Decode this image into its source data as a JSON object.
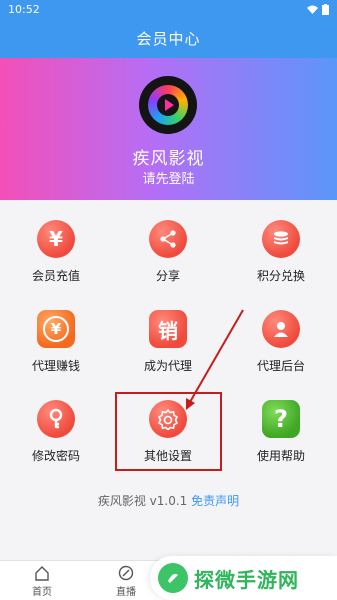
{
  "status": {
    "time": "10:52"
  },
  "header": {
    "title": "会员中心"
  },
  "profile": {
    "app_name": "疾风影视",
    "login_hint": "请先登陆"
  },
  "menu": [
    {
      "label": "会员充值",
      "icon": "yen-icon"
    },
    {
      "label": "分享",
      "icon": "share-icon"
    },
    {
      "label": "积分兑换",
      "icon": "coins-icon"
    },
    {
      "label": "代理赚钱",
      "icon": "yen-coin-icon"
    },
    {
      "label": "成为代理",
      "icon": "sell-icon",
      "glyph": "销"
    },
    {
      "label": "代理后台",
      "icon": "user-icon"
    },
    {
      "label": "修改密码",
      "icon": "key-icon"
    },
    {
      "label": "其他设置",
      "icon": "settings-icon"
    },
    {
      "label": "使用帮助",
      "icon": "help-icon",
      "glyph": "?"
    }
  ],
  "footer": {
    "version": "疾风影视 v1.0.1 ",
    "disclaimer": "免责声明"
  },
  "tabs": [
    {
      "label": "首页"
    },
    {
      "label": "直播"
    }
  ],
  "watermark": {
    "text": "探微手游网"
  },
  "colors": {
    "accent": "#3e98f0",
    "icon_red": "#ef4a3b",
    "icon_orange": "#f36a1e",
    "help_green": "#4caf30",
    "highlight": "#c51d1d"
  }
}
